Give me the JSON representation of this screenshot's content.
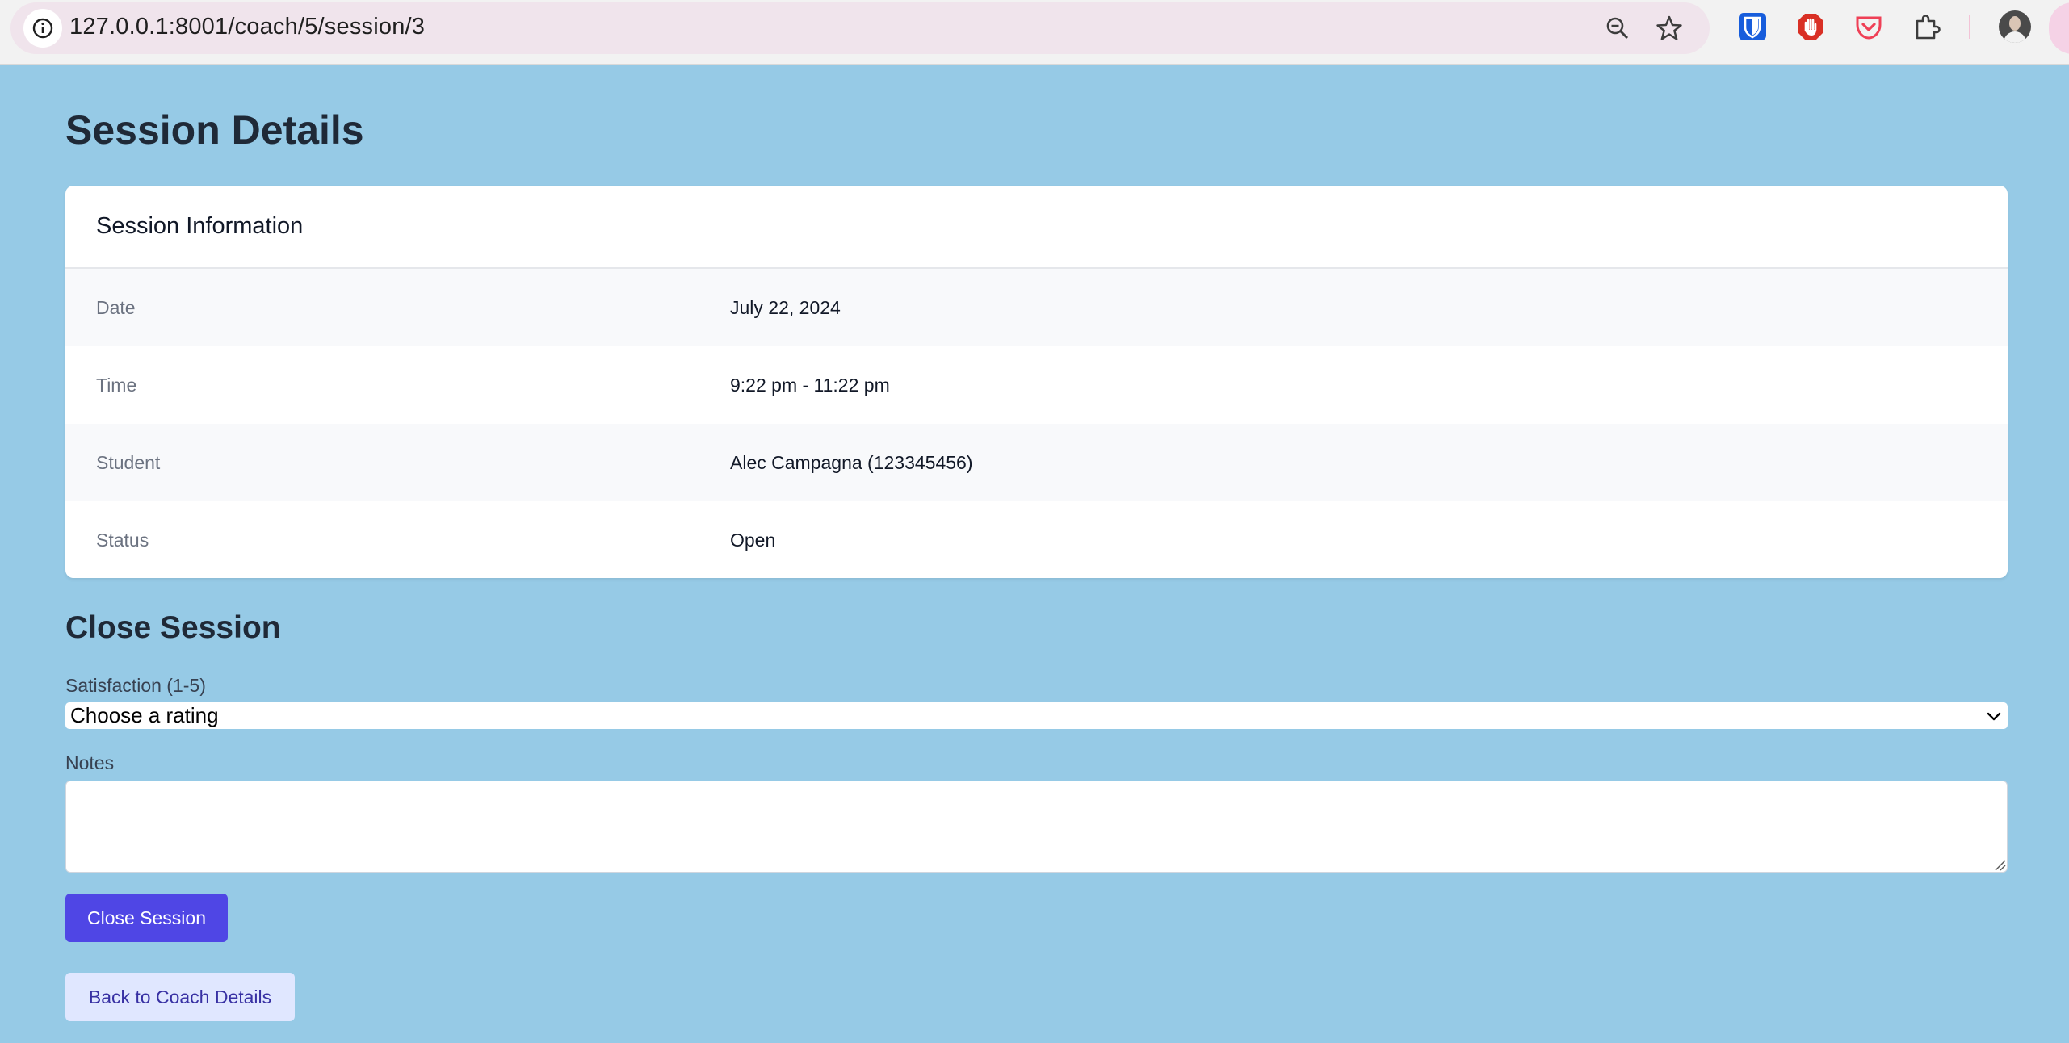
{
  "browser": {
    "url": "127.0.0.1:8001/coach/5/session/3",
    "icons": [
      "info-icon",
      "zoom-icon",
      "bookmark-star-icon",
      "bitwarden-icon",
      "adblock-icon",
      "pocket-icon",
      "extensions-icon",
      "profile-avatar"
    ]
  },
  "page": {
    "title": "Session Details"
  },
  "session_info": {
    "heading": "Session Information",
    "rows": [
      {
        "label": "Date",
        "value": "July 22, 2024"
      },
      {
        "label": "Time",
        "value": "9:22 pm - 11:22 pm"
      },
      {
        "label": "Student",
        "value": "Alec Campagna (123345456)"
      },
      {
        "label": "Status",
        "value": "Open"
      }
    ]
  },
  "close_session": {
    "heading": "Close Session",
    "satisfaction_label": "Satisfaction (1-5)",
    "satisfaction_selected": "Choose a rating",
    "notes_label": "Notes",
    "notes_value": "",
    "submit_label": "Close Session"
  },
  "back_link": {
    "label": "Back to Coach Details"
  },
  "colors": {
    "page_bg": "#96cae6",
    "primary": "#4f46e5",
    "secondary_bg": "#e0e7ff",
    "secondary_text": "#3730a3"
  }
}
